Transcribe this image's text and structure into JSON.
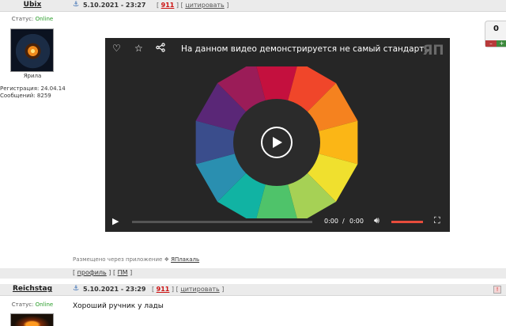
{
  "post1": {
    "username": "Ubix",
    "date": "5.10.2021 - 23:27",
    "post_number": "911",
    "quote_label": "цитировать",
    "status_label": "Статус:",
    "status_value": "Online",
    "avatar_caption": "Ярила",
    "registration": "Регистрация: 24.04.14",
    "messages": "Сообщений: 8259",
    "rating": "0",
    "rating_minus": "–",
    "rating_plus": "+",
    "placed_via_text": "Размещено через приложение",
    "placed_via_app": "ЯПлакаль"
  },
  "video": {
    "title": "На данном видео демонстрируется не самый стандарт...",
    "logo_text": "ЯП",
    "time_current": "0:00",
    "time_separator": "/",
    "time_duration": "0:00",
    "volume_level": 1.0,
    "wheel_colors": [
      "#c4103e",
      "#f0462a",
      "#f5821f",
      "#fbb616",
      "#f0e02e",
      "#a6d155",
      "#4fc36a",
      "#11b3a3",
      "#2a8fb0",
      "#3a4d8c",
      "#5a2777",
      "#9b1c58"
    ],
    "wheel_center_color": "#2b2b2b"
  },
  "footer": {
    "profile_label": "профиль",
    "pm_label": "ПМ"
  },
  "post2": {
    "username": "Reichstag",
    "date": "5.10.2021 - 23:29",
    "post_number": "911",
    "quote_label": "цитировать",
    "status_label": "Статус:",
    "status_value": "Online",
    "text": "Хороший ручник у лады"
  },
  "colors": {
    "header_bg": "#ebebeb",
    "online": "#2a9d2a",
    "post_number": "#cc1111",
    "volume_fill": "#e74c3c"
  }
}
